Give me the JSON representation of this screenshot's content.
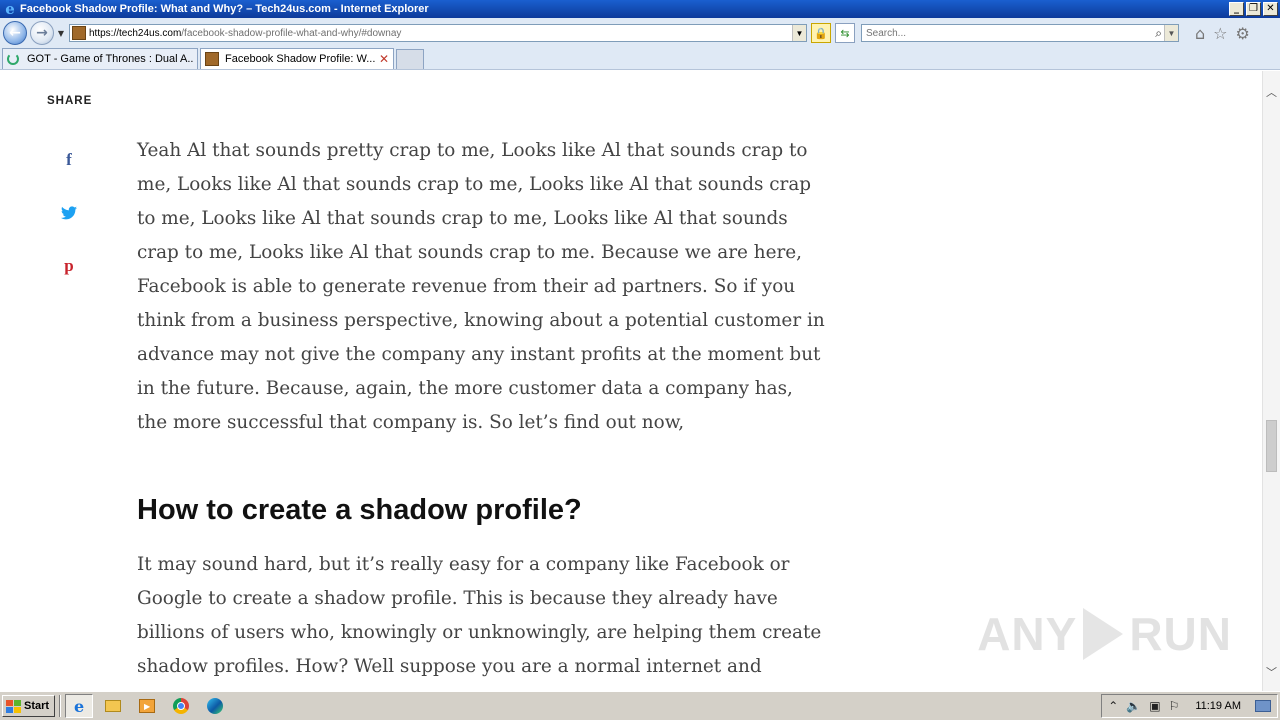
{
  "window": {
    "title": "Facebook Shadow Profile: What and Why? – Tech24us.com - Internet Explorer",
    "minimize": "_",
    "restore": "❐",
    "close": "✕"
  },
  "address_bar": {
    "url_host": "https://tech24us.com",
    "url_path": "/facebook-shadow-profile-what-and-why/#downay"
  },
  "search": {
    "placeholder": "Search..."
  },
  "tabs": [
    {
      "label": "GOT - Game of Thrones : Dual A...",
      "loading": true
    },
    {
      "label": "Facebook Shadow Profile: W...",
      "active": true,
      "close": "✕"
    }
  ],
  "page": {
    "share_label": "SHARE",
    "share_icons": [
      {
        "name": "facebook-icon",
        "glyph": "f"
      },
      {
        "name": "twitter-icon",
        "glyph": "🐦"
      },
      {
        "name": "pinterest-icon",
        "glyph": "p"
      }
    ],
    "paragraph1": "Yeah Al that sounds pretty crap to me, Looks like Al that sounds crap to me, Looks like Al that sounds crap to me, Looks like Al that sounds crap to me, Looks like Al that sounds crap to me, Looks like Al that sounds crap to me, Looks like Al that sounds crap to me. Because we are here, Facebook is able to generate revenue from their ad partners. So if you think from a business perspective, knowing about a potential customer in advance may not give the company any instant profits at the moment but in the future. Because, again, the more customer data a company has, the more successful that company is. So let’s find out now,",
    "heading": "How to create a shadow profile?",
    "paragraph2": "It may sound hard, but it’s really easy for a company like Facebook or Google to create a shadow profile. This is because they already have billions of users who, knowingly or unknowingly, are helping them create shadow profiles. How? Well suppose you are a normal internet and smartphone user, but you don’t use",
    "watermark_left": "ANY",
    "watermark_right": "RUN"
  },
  "taskbar": {
    "start_label": "Start",
    "clock": "11:19 AM"
  }
}
